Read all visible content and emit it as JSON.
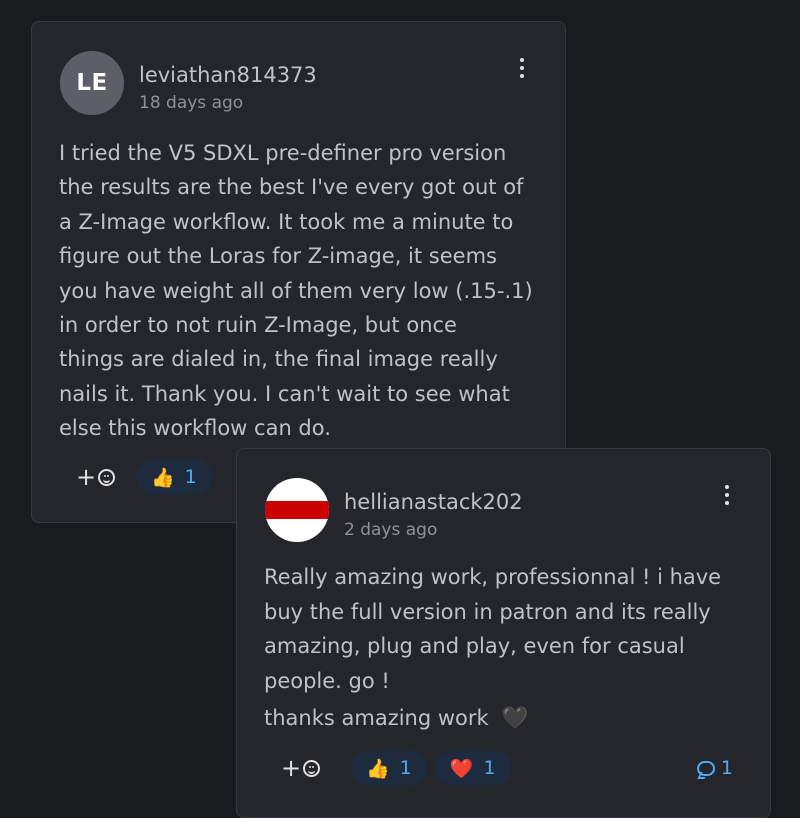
{
  "comments": [
    {
      "avatar_initials": "LE",
      "username": "leviathan814373",
      "time": "18 days ago",
      "text_lines": [
        "I tried the V5 SDXL pre-definer pro version",
        "the results are the best I've every got out of",
        "a Z-Image workflow. It took me a minute to",
        "figure out the Loras for Z-image, it seems",
        "you have weight all of them very low (.15-.1)",
        "in order to not ruin Z-Image, but once",
        "things are dialed in, the final image really",
        "nails it. Thank you. I can't wait to see what",
        "else this workflow can do."
      ],
      "add_reaction_label": "+",
      "reactions": [
        {
          "emoji": "👍",
          "count": "1"
        }
      ]
    },
    {
      "avatar_flag_colors": {
        "top": "#ffffff",
        "middle": "#cc0000",
        "bottom": "#ffffff"
      },
      "username": "hellianastack202",
      "time": "2 days ago",
      "text_lines": [
        "Really amazing work, professionnal ! i have",
        "buy the full version in patron and its really",
        "amazing, plug and play, even for casual",
        "people. go !"
      ],
      "text_thanks": "thanks amazing work",
      "text_thanks_emoji": "🖤",
      "add_reaction_label": "+",
      "reactions": [
        {
          "emoji": "👍",
          "count": "1"
        },
        {
          "emoji": "❤️",
          "count": "1"
        }
      ],
      "comment_count": "1"
    }
  ],
  "colors": {
    "background": "#1a1b1e",
    "card": "#25262b",
    "card_border": "#373a40",
    "accent": "#4dabf7",
    "reaction_pill": "#1e2a3d"
  }
}
